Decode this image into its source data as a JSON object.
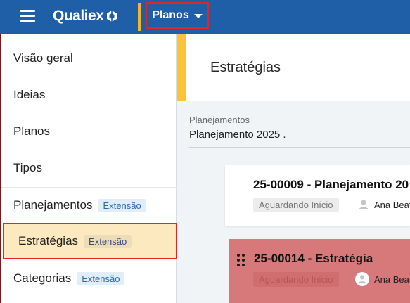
{
  "topbar": {
    "brand": "Qualiex",
    "menu_label": "Planos"
  },
  "sidebar": {
    "items": [
      {
        "label": "Visão geral"
      },
      {
        "label": "Ideias"
      },
      {
        "label": "Planos"
      },
      {
        "label": "Tipos"
      },
      {
        "label": "Planejamentos",
        "badge": "Extensão"
      },
      {
        "label": "Estratégias",
        "badge": "Extensão",
        "active": true
      },
      {
        "label": "Categorias",
        "badge": "Extensão"
      }
    ]
  },
  "main": {
    "title": "Estratégias",
    "breadcrumb_label": "Planejamentos",
    "breadcrumb_value": "Planejamento 2025 ."
  },
  "cards": [
    {
      "title": "25-00009 - Planejamento 20",
      "status": "Aguardando Início",
      "owner": "Ana Beat"
    },
    {
      "title": "25-00014 - Estratégia",
      "status": "Aguardando Início",
      "owner": "Ana Beat"
    }
  ],
  "colors": {
    "topbar": "#1f5fa8",
    "accent": "#fbc436",
    "active_item": "#fde9c0",
    "highlight_border": "#e02626",
    "card_selected": "#d7787a"
  }
}
